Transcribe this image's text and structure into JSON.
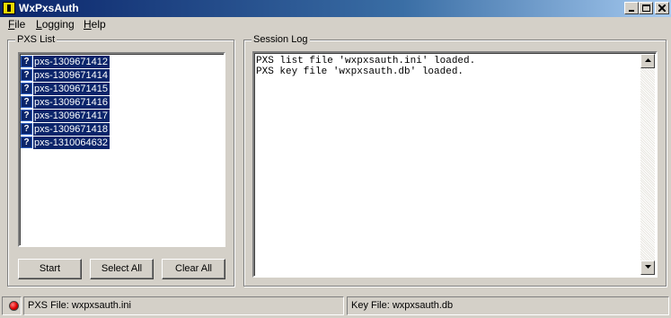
{
  "window": {
    "title": "WxPxsAuth"
  },
  "menu": {
    "file": {
      "mnemonic": "F",
      "rest": "ile"
    },
    "logging": {
      "mnemonic": "L",
      "rest": "ogging"
    },
    "help": {
      "mnemonic": "H",
      "rest": "elp"
    }
  },
  "pxs_list": {
    "label": "PXS List",
    "items": [
      {
        "label": "pxs-1309671412",
        "icon": "question-icon"
      },
      {
        "label": "pxs-1309671414",
        "icon": "question-icon"
      },
      {
        "label": "pxs-1309671415",
        "icon": "question-icon"
      },
      {
        "label": "pxs-1309671416",
        "icon": "question-icon"
      },
      {
        "label": "pxs-1309671417",
        "icon": "question-icon"
      },
      {
        "label": "pxs-1309671418",
        "icon": "question-icon"
      },
      {
        "label": "pxs-1310064632",
        "icon": "question-icon"
      }
    ],
    "buttons": {
      "start": "Start",
      "select_all": "Select All",
      "clear_all": "Clear All"
    }
  },
  "session_log": {
    "label": "Session Log",
    "lines": [
      "PXS list file 'wxpxsauth.ini' loaded.",
      "PXS key file 'wxpxsauth.db' loaded."
    ]
  },
  "status": {
    "pxs_file": "PXS File: wxpxsauth.ini",
    "key_file": "Key File: wxpxsauth.db",
    "indicator_color": "#e00000"
  },
  "colors": {
    "selection": "#0a246a",
    "face": "#d4d0c8"
  }
}
